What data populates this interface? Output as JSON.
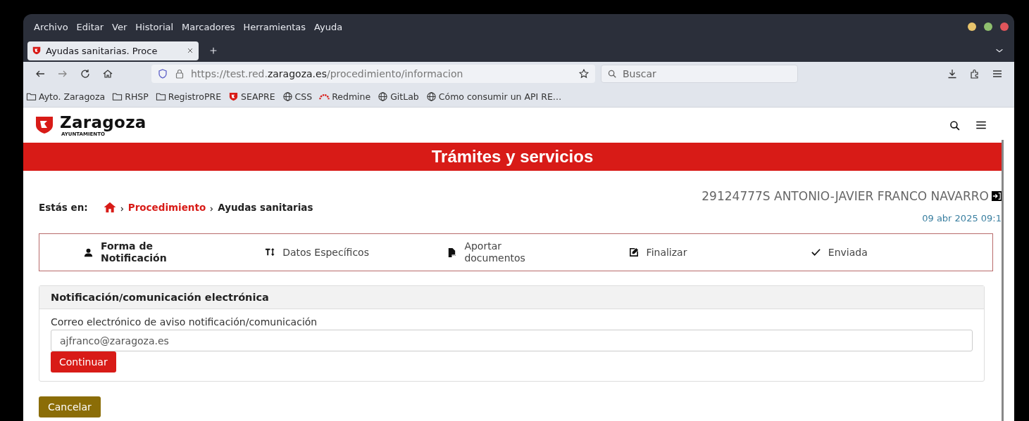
{
  "menu": [
    "Archivo",
    "Editar",
    "Ver",
    "Historial",
    "Marcadores",
    "Herramientas",
    "Ayuda"
  ],
  "tabs": [
    {
      "title": "Ayudas sanitarias. Proce",
      "selected": true
    }
  ],
  "address": {
    "prefix": "https://test.red.",
    "domain": "zaragoza.es",
    "path": "/procedimiento/informacion"
  },
  "search": {
    "placeholder": "Buscar"
  },
  "bookmarks": [
    {
      "kind": "folder",
      "label": "Ayto. Zaragoza"
    },
    {
      "kind": "folder",
      "label": "RHSP"
    },
    {
      "kind": "folder",
      "label": "RegistroPRE"
    },
    {
      "kind": "shield",
      "label": "SEAPRE"
    },
    {
      "kind": "globe",
      "label": "CSS"
    },
    {
      "kind": "arch",
      "label": "Redmine"
    },
    {
      "kind": "globe",
      "label": "GitLab"
    },
    {
      "kind": "globe",
      "label": "Cómo consumir un API RE…"
    }
  ],
  "site": {
    "brand": "Zaragoza",
    "sub": "AYUNTAMIENTO",
    "banner": "Trámites y servicios"
  },
  "breadcrumb": {
    "lead": "Estás en:",
    "items": [
      {
        "label": "Procedimiento",
        "link": true
      },
      {
        "label": "Ayudas sanitarias",
        "link": false
      }
    ]
  },
  "user": {
    "name": "29124777S ANTONIO-JAVIER FRANCO NAVARRO",
    "date": "09 abr 2025 09:1"
  },
  "steps": [
    {
      "kind": "user",
      "label": "Forma de Notificación",
      "selected": true
    },
    {
      "kind": "text",
      "label": "Datos Específicos",
      "selected": false
    },
    {
      "kind": "pdf",
      "label": "Aportar documentos",
      "selected": false
    },
    {
      "kind": "edit",
      "label": "Finalizar",
      "selected": false
    },
    {
      "kind": "check",
      "label": "Enviada",
      "selected": false
    }
  ],
  "panel": {
    "title": "Notificación/comunicación electrónica",
    "field_label": "Correo electrónico de aviso notificación/comunicación",
    "value": "ajfranco@zaragoza.es",
    "submit": "Continuar"
  },
  "cancel": "Cancelar"
}
